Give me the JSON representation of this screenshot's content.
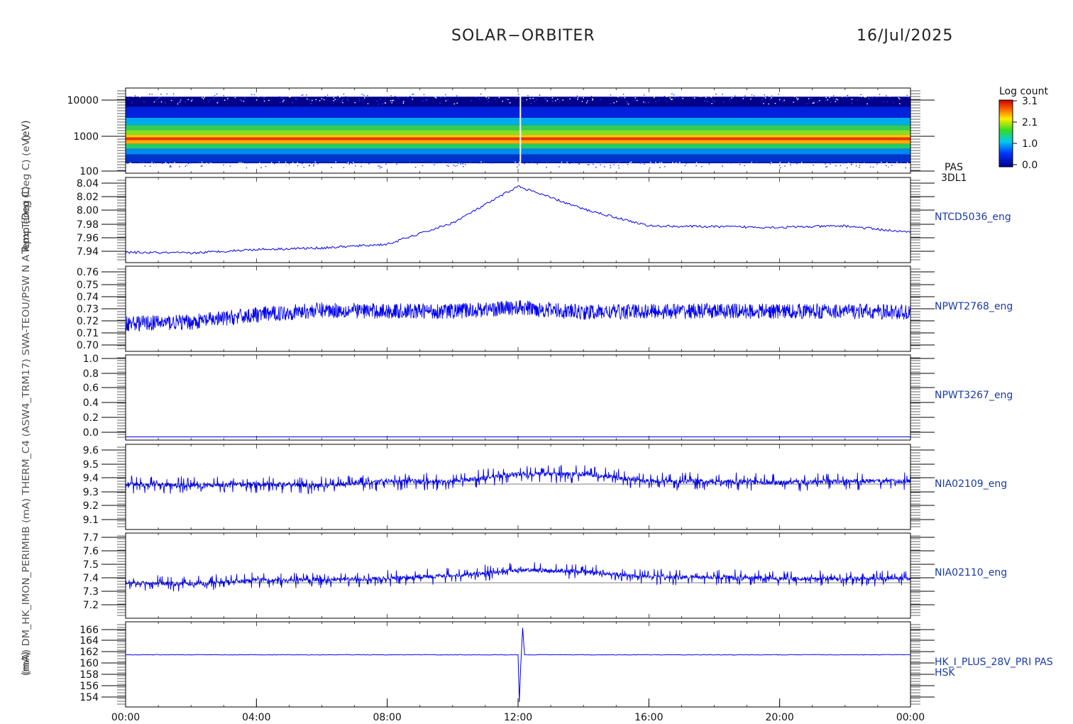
{
  "header": {
    "mission": "SOLAR−ORBITER",
    "date": "16/Jul/2025"
  },
  "colorbar": {
    "title": "Log count",
    "ticks": [
      "3.1",
      "2.1",
      "1.0",
      "0.0"
    ]
  },
  "time_axis": {
    "ticks": [
      "00:00",
      "04:00",
      "08:00",
      "12:00",
      "16:00",
      "20:00",
      "00:00"
    ]
  },
  "colors": {
    "trace": "#0000ee",
    "label": "#1a3aa8",
    "axis": "#000000"
  },
  "chart_data": [
    {
      "type": "heatmap",
      "id": "pas",
      "ylabel": "(eV)",
      "yscale": "log",
      "ylim": [
        100,
        15000
      ],
      "yticks": [
        "10000",
        "1000",
        "100"
      ],
      "right_label": [
        "PAS",
        "3DL1"
      ],
      "x": [
        "00:00",
        "24:00"
      ],
      "colorbar_range": [
        0.0,
        3.1
      ]
    },
    {
      "type": "line",
      "id": "ntcd",
      "ylabel": "Temp (Deg C)",
      "ylim": [
        7.928,
        8.044
      ],
      "yticks": [
        "8.04",
        "8.02",
        "8.00",
        "7.98",
        "7.96",
        "7.94"
      ],
      "right_label": [
        "NTCD5036_eng"
      ],
      "x_hours": [
        0,
        2,
        4,
        6,
        8,
        10,
        12,
        14,
        16,
        18,
        20,
        22,
        24
      ],
      "values": [
        7.942,
        7.941,
        7.946,
        7.948,
        7.953,
        7.982,
        8.032,
        8.001,
        7.978,
        7.977,
        7.976,
        7.978,
        7.969
      ]
    },
    {
      "type": "line",
      "id": "npwt2768",
      "ylabel": "",
      "ylim": [
        0.693,
        0.763
      ],
      "yticks": [
        "0.76",
        "0.75",
        "0.74",
        "0.73",
        "0.72",
        "0.71",
        "0.70"
      ],
      "right_label": [
        "NPWT2768_eng"
      ],
      "x_hours": [
        0,
        2,
        4,
        6,
        8,
        10,
        12,
        14,
        16,
        18,
        20,
        22,
        24
      ],
      "values": [
        0.716,
        0.717,
        0.723,
        0.727,
        0.726,
        0.726,
        0.729,
        0.725,
        0.726,
        0.726,
        0.726,
        0.726,
        0.725
      ]
    },
    {
      "type": "line",
      "id": "npwt3267",
      "ylabel": "",
      "ylim": [
        -0.04,
        1.02
      ],
      "yticks": [
        "1.0",
        "0.8",
        "0.6",
        "0.4",
        "0.2",
        "0.0"
      ],
      "right_label": [
        "NPWT3267_eng"
      ],
      "x_hours": [
        0,
        24
      ],
      "values": [
        0.0,
        0.0
      ]
    },
    {
      "type": "line",
      "id": "nia02109",
      "ylabel": "",
      "ylim": [
        9.03,
        9.63
      ],
      "yticks": [
        "9.6",
        "9.5",
        "9.4",
        "9.3",
        "9.2",
        "9.1"
      ],
      "right_label": [
        "NIA02109_eng"
      ],
      "x_hours": [
        0,
        2,
        4,
        6,
        8,
        10,
        12,
        14,
        16,
        18,
        20,
        22,
        24
      ],
      "values": [
        9.35,
        9.34,
        9.35,
        9.34,
        9.37,
        9.37,
        9.42,
        9.42,
        9.37,
        9.37,
        9.36,
        9.37,
        9.37
      ]
    },
    {
      "type": "line",
      "id": "nia02110",
      "ylabel": "",
      "ylim": [
        7.13,
        7.73
      ],
      "yticks": [
        "7.7",
        "7.6",
        "7.5",
        "7.4",
        "7.3",
        "7.2"
      ],
      "right_label": [
        "NIA02110_eng"
      ],
      "x_hours": [
        0,
        2,
        4,
        6,
        8,
        10,
        12,
        14,
        16,
        18,
        20,
        22,
        24
      ],
      "values": [
        7.38,
        7.37,
        7.4,
        7.4,
        7.41,
        7.43,
        7.47,
        7.46,
        7.42,
        7.42,
        7.41,
        7.41,
        7.41
      ]
    },
    {
      "type": "line",
      "id": "hk28v",
      "ylabel": "(mA)",
      "ylim": [
        152.8,
        167.0
      ],
      "yticks": [
        "166",
        "164",
        "162",
        "160",
        "158",
        "156",
        "154"
      ],
      "right_label": [
        "HK_I_PLUS_28V_PRI PAS",
        "HSK"
      ],
      "x_hours": [
        0,
        4,
        8,
        12.0,
        12.05,
        12.1,
        12.15,
        12.2,
        16,
        20,
        24
      ],
      "values": [
        161.5,
        161.5,
        161.5,
        161.5,
        154.0,
        159.0,
        166.0,
        161.5,
        161.5,
        161.5,
        161.5
      ]
    }
  ],
  "left_axis_label": "(mA) DM_HK_IMON_PERIMHB (mA) THERM_C4 (ASW4_TRM17) SWA-TEOU/PSW N A Apx Temp (Deg C) (eV)"
}
